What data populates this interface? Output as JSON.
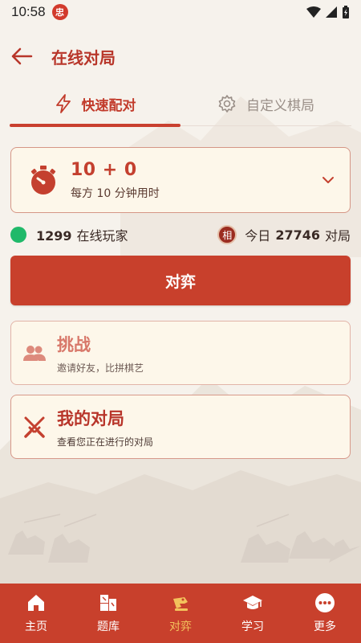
{
  "status_bar": {
    "time": "10:58",
    "app_badge": "忠"
  },
  "header": {
    "title": "在线对局"
  },
  "tabs": [
    {
      "label": "快速配对",
      "icon": "lightning-icon",
      "active": true
    },
    {
      "label": "自定义棋局",
      "icon": "gear-icon",
      "active": false
    }
  ],
  "time_control": {
    "main": "10 + 0",
    "sub": "每方 10 分钟用时"
  },
  "stats": {
    "online_count": "1299",
    "online_label": "在线玩家",
    "badge": "相",
    "today_label": "今日",
    "today_count": "27746",
    "today_suffix": "对局"
  },
  "play_button": {
    "label": "对弈"
  },
  "options": {
    "challenge": {
      "title": "挑战",
      "subtitle": "邀请好友，比拼棋艺",
      "icon": "users-icon"
    },
    "my_games": {
      "title": "我的对局",
      "subtitle": "查看您正在进行的对局",
      "icon": "crossed-swords-icon"
    }
  },
  "bottom_nav": [
    {
      "label": "主页",
      "icon": "home-icon",
      "active": false
    },
    {
      "label": "题库",
      "icon": "puzzle-icon",
      "active": false
    },
    {
      "label": "对弈",
      "icon": "play-icon",
      "active": true
    },
    {
      "label": "学习",
      "icon": "graduation-cap-icon",
      "active": false
    },
    {
      "label": "更多",
      "icon": "more-icon",
      "active": false
    }
  ],
  "colors": {
    "accent": "#c8402c",
    "active_nav": "#f3c25c",
    "online": "#20b96a",
    "card_bg": "#fdf7ea"
  }
}
